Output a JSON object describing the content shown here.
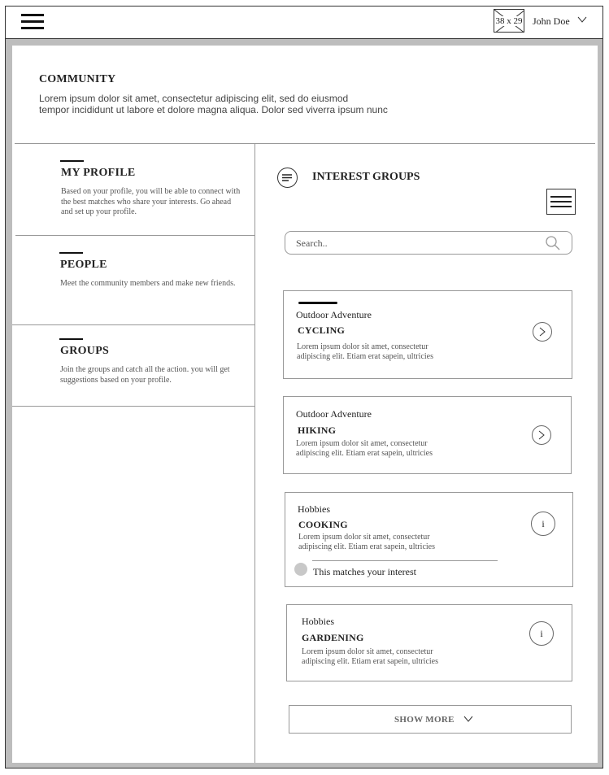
{
  "header": {
    "avatar_placeholder": "38 x 29",
    "user_name": "John Doe"
  },
  "community": {
    "title": "COMMUNITY",
    "description_line1": "Lorem ipsum dolor sit amet, consectetur adipiscing elit, sed do eiusmod",
    "description_line2": "tempor incididunt ut labore et dolore magna aliqua. Dolor sed viverra ipsum nunc"
  },
  "sidebar": {
    "items": [
      {
        "title": "MY PROFILE",
        "description": "Based on your profile, you will  be able to connect with the best matches who share your interests. Go ahead and set up your profile."
      },
      {
        "title": "PEOPLE",
        "description": "Meet the community members and make new friends."
      },
      {
        "title": "GROUPS",
        "description": "Join the groups and catch all the action. you will get suggestions based on your profile."
      }
    ]
  },
  "interest_groups": {
    "title": "INTEREST GROUPS",
    "search_placeholder": "Search..",
    "cards": [
      {
        "category": "Outdoor Adventure",
        "name": "CYCLING",
        "description": "Lorem ipsum dolor sit amet, consectetur adipiscing elit. Etiam erat sapein, ultricies",
        "action_icon": "chevron-right-icon"
      },
      {
        "category": "Outdoor Adventure",
        "name": "HIKING",
        "description": "Lorem ipsum dolor sit amet, consectetur adipiscing elit. Etiam erat sapein, ultricies",
        "action_icon": "chevron-right-icon"
      },
      {
        "category": "Hobbies",
        "name": "COOKING",
        "description": "Lorem ipsum dolor sit amet, consectetur adipiscing elit. Etiam erat sapein, ultricies",
        "action_icon": "info-icon",
        "info_label": "i",
        "match_text": "This matches your interest"
      },
      {
        "category": "Hobbies",
        "name": "GARDENING",
        "description": "Lorem ipsum dolor sit amet, consectetur adipiscing elit. Etiam erat sapein, ultricies",
        "action_icon": "info-icon",
        "info_label": "i"
      }
    ],
    "show_more_label": "SHOW MORE"
  },
  "colors": {
    "frame_gray": "#bdbdbd",
    "border": "#999999",
    "text": "#222222"
  }
}
